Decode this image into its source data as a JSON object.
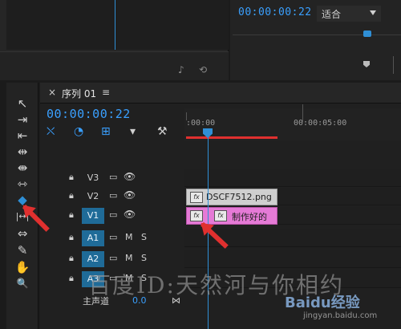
{
  "source_monitor": {
    "ctrl_a": "♪",
    "ctrl_b": "⟲"
  },
  "program_monitor": {
    "timecode": "00:00:00:22",
    "fit_label": "适合"
  },
  "sequence": {
    "close_label": "×",
    "title": "序列 01",
    "menu_label": "≡",
    "timecode": "00:00:00:22",
    "ruler_start": ":00:00",
    "ruler_mark": "00:00:05:00"
  },
  "tools": [
    {
      "label": "↖",
      "name": "selection-tool-icon"
    },
    {
      "label": "⇥",
      "name": "track-select-forward-icon"
    },
    {
      "label": "⇤",
      "name": "ripple-edit-icon"
    },
    {
      "label": "⇹",
      "name": "rolling-edit-icon"
    },
    {
      "label": "⇼",
      "name": "rate-stretch-icon"
    },
    {
      "label": "⇿",
      "name": "razor-tool-icon"
    },
    {
      "label": "◆",
      "name": "rate-stretch-tool-icon"
    },
    {
      "label": "|↔|",
      "name": "slip-tool-icon"
    },
    {
      "label": "⇔",
      "name": "slide-tool-icon"
    },
    {
      "label": "✎",
      "name": "pen-tool-icon"
    },
    {
      "label": "✋",
      "name": "hand-tool-icon"
    },
    {
      "label": "🔍",
      "name": "zoom-tool-icon"
    }
  ],
  "tracks": [
    {
      "name": "V3",
      "kind": "video"
    },
    {
      "name": "V2",
      "kind": "video"
    },
    {
      "name": "V1",
      "kind": "video"
    },
    {
      "name": "A1",
      "kind": "audio"
    },
    {
      "name": "A2",
      "kind": "audio"
    },
    {
      "name": "A3",
      "kind": "audio"
    }
  ],
  "track_controls": {
    "lock": "🔒",
    "film": "▭",
    "eye": "👁",
    "mute": "M",
    "solo": "S"
  },
  "clips": {
    "png_name": "DSCF7512.png",
    "pink_name": "制作好的",
    "fx_label": "fx"
  },
  "master": {
    "label": "主声道",
    "value": "0.0",
    "marker": "⋈"
  },
  "watermark": {
    "text": "百度ID:天然河与你相约",
    "brand": "Baidu经验",
    "url": "jingyan.baidu.com"
  },
  "colors": {
    "accent": "#2f8fd6",
    "annotation": "#e0302f",
    "clip_pink": "#e57ad6",
    "selected_track": "#1f6b98"
  }
}
